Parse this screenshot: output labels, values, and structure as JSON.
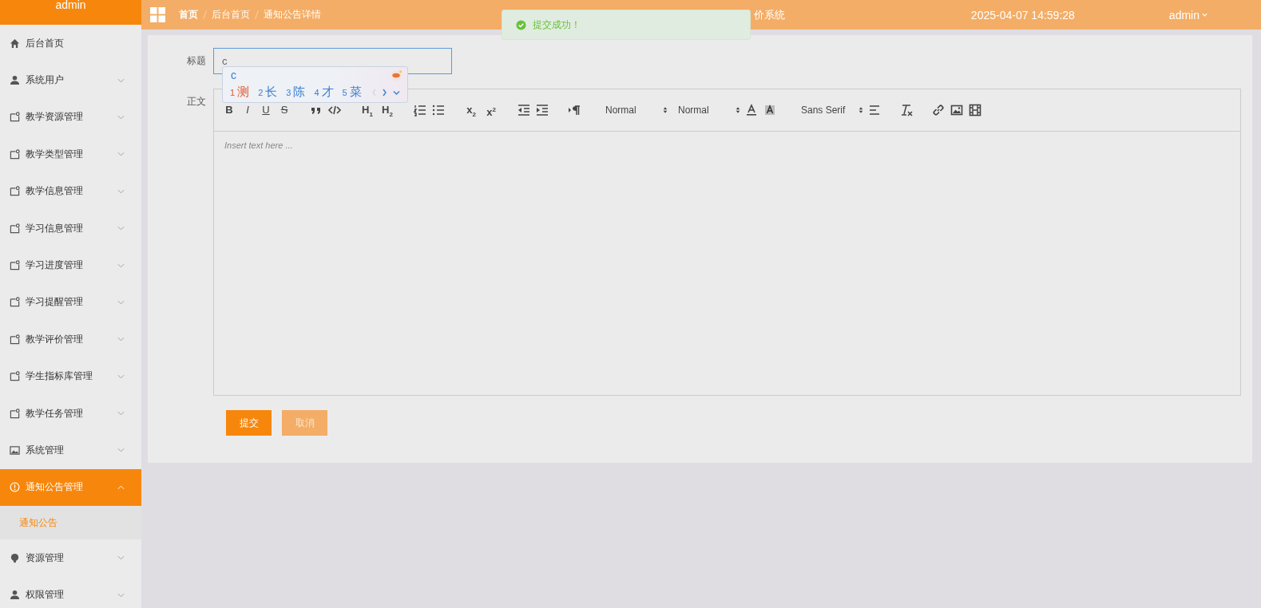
{
  "sidebar": {
    "brand": "admin",
    "items": [
      {
        "label": "后台首页",
        "kind": "home",
        "selected": false
      },
      {
        "label": "系统用户",
        "kind": "user",
        "selected": false,
        "expanded": false
      },
      {
        "label": "教学资源管理",
        "kind": "module",
        "selected": false,
        "expanded": false
      },
      {
        "label": "教学类型管理",
        "kind": "module",
        "selected": false,
        "expanded": false
      },
      {
        "label": "教学信息管理",
        "kind": "module",
        "selected": false,
        "expanded": false
      },
      {
        "label": "学习信息管理",
        "kind": "module",
        "selected": false,
        "expanded": false
      },
      {
        "label": "学习进度管理",
        "kind": "module",
        "selected": false,
        "expanded": false
      },
      {
        "label": "学习提醒管理",
        "kind": "module",
        "selected": false,
        "expanded": false
      },
      {
        "label": "教学评价管理",
        "kind": "module",
        "selected": false,
        "expanded": false
      },
      {
        "label": "学生指标库管理",
        "kind": "module",
        "selected": false,
        "expanded": false
      },
      {
        "label": "教学任务管理",
        "kind": "module",
        "selected": false,
        "expanded": false
      },
      {
        "label": "系统管理",
        "kind": "picture",
        "selected": false,
        "expanded": false
      },
      {
        "label": "通知公告管理",
        "kind": "alert",
        "selected": true,
        "expanded": true,
        "children": [
          {
            "label": "通知公告",
            "selected": true
          }
        ]
      },
      {
        "label": "资源管理",
        "kind": "bulb",
        "selected": false,
        "expanded": false
      },
      {
        "label": "权限管理",
        "kind": "user",
        "selected": false,
        "expanded": false
      }
    ]
  },
  "header": {
    "breadcrumbs": [
      "首页",
      "后台首页",
      "通知公告详情"
    ],
    "title": "价系统",
    "datetime": "2025-04-07 14:59:28",
    "user": "admin"
  },
  "toast": {
    "message": "提交成功！"
  },
  "form": {
    "title_label": "标题",
    "title_value": "c",
    "body_label": "正文",
    "body_placeholder": "Insert text here ...",
    "toolbar": [
      {
        "kind": "bold",
        "label": "B"
      },
      {
        "kind": "italic",
        "label": "I"
      },
      {
        "kind": "underline",
        "label": "U"
      },
      {
        "kind": "strike",
        "label": "S"
      },
      {
        "kind": "gap"
      },
      {
        "kind": "blockquote"
      },
      {
        "kind": "code"
      },
      {
        "kind": "gap"
      },
      {
        "kind": "heading",
        "label": "H",
        "sub": "1"
      },
      {
        "kind": "heading",
        "label": "H",
        "sub": "2"
      },
      {
        "kind": "gap"
      },
      {
        "kind": "ordered-list"
      },
      {
        "kind": "bullet-list"
      },
      {
        "kind": "gap"
      },
      {
        "kind": "script",
        "label": "x",
        "sub": "2"
      },
      {
        "kind": "script",
        "label": "x",
        "sup": "2"
      },
      {
        "kind": "gap"
      },
      {
        "kind": "outdent"
      },
      {
        "kind": "indent"
      },
      {
        "kind": "gap"
      },
      {
        "kind": "direction"
      },
      {
        "kind": "gap"
      },
      {
        "kind": "select",
        "label": "Normal"
      },
      {
        "kind": "select",
        "label": "Normal"
      },
      {
        "kind": "color"
      },
      {
        "kind": "background"
      },
      {
        "kind": "gap"
      },
      {
        "kind": "select",
        "label": "Sans Serif"
      },
      {
        "kind": "align"
      },
      {
        "kind": "gap"
      },
      {
        "kind": "clean"
      },
      {
        "kind": "gap"
      },
      {
        "kind": "link"
      },
      {
        "kind": "image"
      },
      {
        "kind": "video"
      }
    ],
    "buttons": [
      {
        "label": "提交",
        "kind": "primary"
      },
      {
        "label": "取消",
        "kind": "secondary"
      }
    ]
  },
  "ime": {
    "composition": "c",
    "candidates": [
      {
        "number": "1",
        "text": "测",
        "selected": true
      },
      {
        "number": "2",
        "text": "长",
        "selected": false
      },
      {
        "number": "3",
        "text": "陈",
        "selected": false
      },
      {
        "number": "4",
        "text": "才",
        "selected": false
      },
      {
        "number": "5",
        "text": "菜",
        "selected": false
      }
    ]
  }
}
